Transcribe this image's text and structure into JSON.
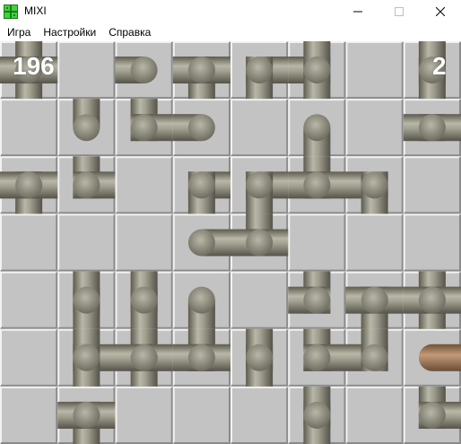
{
  "window": {
    "title": "MIXI",
    "icon": "green-grid-app-icon",
    "buttons": {
      "minimize": "minimize-icon",
      "maximize": "maximize-icon",
      "close": "close-icon"
    }
  },
  "menu": {
    "items": [
      "Игра",
      "Настройки",
      "Справка"
    ]
  },
  "game": {
    "score_left": "196",
    "score_right": "2",
    "grid": {
      "rows": 7,
      "cols": 8
    },
    "pipe_color": "#8e8c7c",
    "tile_color": "#c3c3c3",
    "active_pipe_color": "#a57e5f",
    "pieces": [
      {
        "r": 0,
        "c": 0,
        "conn": "NESW"
      },
      {
        "r": 0,
        "c": 2,
        "conn": "W"
      },
      {
        "r": 0,
        "c": 3,
        "conn": "ESW"
      },
      {
        "r": 0,
        "c": 4,
        "conn": "ES"
      },
      {
        "r": 0,
        "c": 5,
        "conn": "NWS"
      },
      {
        "r": 0,
        "c": 7,
        "conn": "NS"
      },
      {
        "r": 1,
        "c": 1,
        "conn": "N"
      },
      {
        "r": 1,
        "c": 2,
        "conn": "NE"
      },
      {
        "r": 1,
        "c": 3,
        "conn": "W"
      },
      {
        "r": 1,
        "c": 5,
        "conn": "S"
      },
      {
        "r": 1,
        "c": 7,
        "conn": "EW"
      },
      {
        "r": 2,
        "c": 0,
        "conn": "ESW"
      },
      {
        "r": 2,
        "c": 1,
        "conn": "NE"
      },
      {
        "r": 2,
        "c": 3,
        "conn": "ES"
      },
      {
        "r": 2,
        "c": 4,
        "conn": "ES"
      },
      {
        "r": 2,
        "c": 5,
        "conn": "NEW"
      },
      {
        "r": 2,
        "c": 6,
        "conn": "WS"
      },
      {
        "r": 3,
        "c": 3,
        "conn": "E"
      },
      {
        "r": 3,
        "c": 4,
        "conn": "NEW"
      },
      {
        "r": 4,
        "c": 1,
        "conn": "NS"
      },
      {
        "r": 4,
        "c": 2,
        "conn": "NS"
      },
      {
        "r": 4,
        "c": 3,
        "conn": "S"
      },
      {
        "r": 4,
        "c": 5,
        "conn": "NW"
      },
      {
        "r": 4,
        "c": 6,
        "conn": "ESW"
      },
      {
        "r": 4,
        "c": 7,
        "conn": "NESW"
      },
      {
        "r": 5,
        "c": 1,
        "conn": "NES"
      },
      {
        "r": 5,
        "c": 2,
        "conn": "NESW"
      },
      {
        "r": 5,
        "c": 3,
        "conn": "NEW"
      },
      {
        "r": 5,
        "c": 4,
        "conn": "NS"
      },
      {
        "r": 5,
        "c": 5,
        "conn": "NE"
      },
      {
        "r": 5,
        "c": 6,
        "conn": "WN"
      },
      {
        "r": 5,
        "c": 7,
        "conn": "E",
        "active": true
      },
      {
        "r": 6,
        "c": 1,
        "conn": "ESW"
      },
      {
        "r": 6,
        "c": 5,
        "conn": "NS"
      },
      {
        "r": 6,
        "c": 7,
        "conn": "NE"
      }
    ]
  }
}
